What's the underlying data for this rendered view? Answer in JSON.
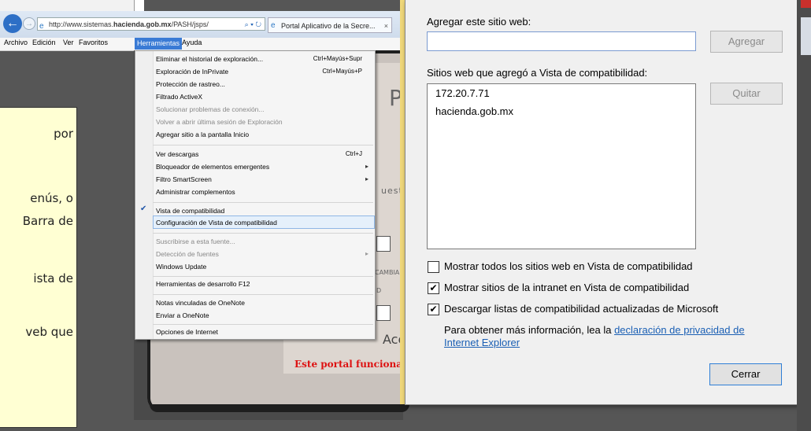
{
  "note": {
    "lines": [
      "por",
      "enús, o",
      "Barra de",
      "ista de",
      "veb que"
    ]
  },
  "browser": {
    "url_prefix": "http://www.sistemas.",
    "url_domain": "hacienda.gob.mx",
    "url_path": "/PASH/jsps/",
    "tab_label": "Portal Aplicativo de la Secre...",
    "menus": [
      "Archivo",
      "Edición",
      "Ver",
      "Favoritos",
      "Herramientas",
      "Ayuda"
    ],
    "active_menu": "Herramientas"
  },
  "portal": {
    "letter_p": "P",
    "fragment_quest": "uest",
    "fragment_cambi": "CAMBIA",
    "fragment_d": "D",
    "fragment_ace": "Ace",
    "footer": "Este portal funciona c"
  },
  "dropdown": {
    "items": [
      {
        "label": "Eliminar el historial de exploración...",
        "shortcut": "Ctrl+Mayús+Supr"
      },
      {
        "label": "Exploración de InPrivate",
        "shortcut": "Ctrl+Mayús+P"
      },
      {
        "label": "Protección de rastreo..."
      },
      {
        "label": "Filtrado ActiveX"
      },
      {
        "label": "Solucionar problemas de conexión...",
        "disabled": true
      },
      {
        "label": "Volver a abrir última sesión de Exploración",
        "disabled": true
      },
      {
        "label": "Agregar sitio a la pantalla Inicio"
      },
      {
        "label": "Ver descargas",
        "shortcut": "Ctrl+J"
      },
      {
        "label": "Bloqueador de elementos emergentes",
        "submenu": true
      },
      {
        "label": "Filtro SmartScreen",
        "submenu": true
      },
      {
        "label": "Administrar complementos"
      },
      {
        "label": "Vista de compatibilidad",
        "checked": true
      },
      {
        "label": "Configuración de Vista de compatibilidad",
        "highlighted": true
      },
      {
        "label": "Suscribirse a esta fuente...",
        "disabled": true
      },
      {
        "label": "Detección de fuentes",
        "disabled": true,
        "submenu": true
      },
      {
        "label": "Windows Update"
      },
      {
        "label": "Herramientas de desarrollo F12"
      },
      {
        "label": "Notas vinculadas de OneNote"
      },
      {
        "label": "Enviar a OneNote"
      },
      {
        "label": "Opciones de Internet"
      }
    ]
  },
  "dialog": {
    "add_label": "Agregar este sitio web:",
    "add_value": "",
    "add_button": "Agregar",
    "list_label": "Sitios web que agregó a Vista de compatibilidad:",
    "sites": [
      "172.20.7.71",
      "hacienda.gob.mx"
    ],
    "remove_button": "Quitar",
    "checkboxes": [
      {
        "label": "Mostrar todos los sitios web en Vista de compatibilidad",
        "checked": false
      },
      {
        "label": "Mostrar sitios de la intranet en Vista de compatibilidad",
        "checked": true
      },
      {
        "label": "Descargar listas de compatibilidad actualizadas de Microsoft",
        "checked": true
      }
    ],
    "info_text": "Para obtener más información, lea la ",
    "info_link_1": "declaración de privacidad de",
    "info_link_2": "Internet Explorer",
    "close_button": "Cerrar"
  },
  "colors": {
    "accent": "#2f7fd6",
    "note_bg": "#ffffd3",
    "portal_footer": "#dd1111"
  }
}
